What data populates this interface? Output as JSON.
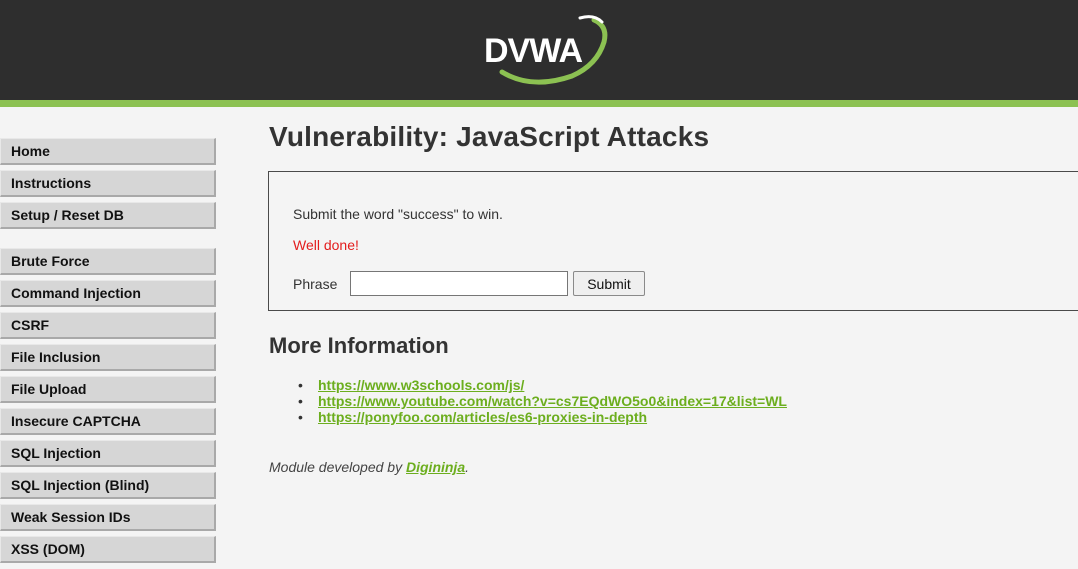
{
  "header": {
    "logo_text": "DVWA"
  },
  "menu": {
    "blocks": [
      [
        {
          "label": "Home"
        },
        {
          "label": "Instructions"
        },
        {
          "label": "Setup / Reset DB"
        }
      ],
      [
        {
          "label": "Brute Force"
        },
        {
          "label": "Command Injection"
        },
        {
          "label": "CSRF"
        },
        {
          "label": "File Inclusion"
        },
        {
          "label": "File Upload"
        },
        {
          "label": "Insecure CAPTCHA"
        },
        {
          "label": "SQL Injection"
        },
        {
          "label": "SQL Injection (Blind)"
        },
        {
          "label": "Weak Session IDs"
        },
        {
          "label": "XSS (DOM)"
        }
      ]
    ]
  },
  "main": {
    "title": "Vulnerability: JavaScript Attacks",
    "instruction": "Submit the word \"success\" to win.",
    "result": "Well done!",
    "result_color": "#e31c1c",
    "phrase_label": "Phrase",
    "phrase_value": "",
    "submit_label": "Submit",
    "more_info_heading": "More Information",
    "links": [
      {
        "text": "https://www.w3schools.com/js/"
      },
      {
        "text": "https://www.youtube.com/watch?v=cs7EQdWO5o0&index=17&list=WL"
      },
      {
        "text": "https://ponyfoo.com/articles/es6-proxies-in-depth"
      }
    ],
    "credit_prefix": "Module developed by ",
    "credit_author": "Digininja",
    "credit_suffix": "."
  },
  "colors": {
    "header_bg": "#2e2e2e",
    "accent_green": "#8cc152",
    "link_green": "#6cae1e"
  }
}
